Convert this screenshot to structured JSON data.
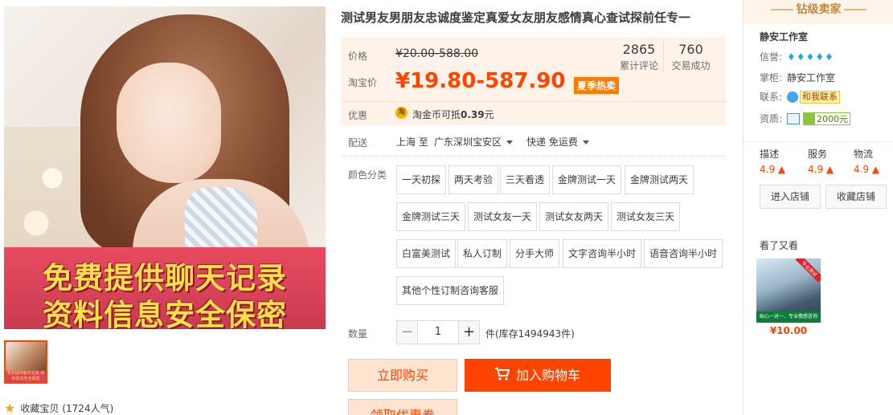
{
  "gallery": {
    "banner_line1": "免费提供聊天记录",
    "banner_line2": "资料信息安全保密",
    "thumb_text": "免费提供聊天记录 资料信息安全保密",
    "collect_label": "收藏宝贝",
    "collect_count": "(1724人气)"
  },
  "item": {
    "title": "测试男友男朋友忠诚度鉴定真爱女友朋友感情真心查试探前任专一",
    "price_label": "价格",
    "original_price": "¥20.00-588.00",
    "taobao_price_label": "淘宝价",
    "current_price": "¥19.80-587.90",
    "promo_tag": "夏季热卖",
    "stats": [
      {
        "num": "2865",
        "label": "累计评论"
      },
      {
        "num": "760",
        "label": "交易成功"
      }
    ],
    "benefit_label": "优惠",
    "coin_icon": "淘",
    "coin_text_prefix": "淘金币可抵",
    "coin_amount": "0.39",
    "coin_unit": "元",
    "ship_label": "配送",
    "ship_from": "上海 至",
    "ship_to": "广东深圳宝安区",
    "ship_method": "快递 免运费",
    "color_label": "颜色分类",
    "options": [
      "一天初探",
      "两天考验",
      "三天看透",
      "金牌测试一天",
      "金牌测试两天",
      "金牌测试三天",
      "测试女友一天",
      "测试女友两天",
      "测试女友三天",
      "白富美测试",
      "私人订制",
      "分手大师",
      "文字咨询半小时",
      "语音咨询半小时",
      "其他个性订制咨询客服"
    ],
    "qty_label": "数量",
    "qty_minus": "−",
    "qty_value": "1",
    "qty_plus": "+",
    "stock_text": "件(库存1494943件)",
    "buy_now": "立即购买",
    "add_to_cart": "加入购物车",
    "coupon": "领取优惠券"
  },
  "shop": {
    "level_title": "钻级卖家",
    "name": "静安工作室",
    "credit_label": "信誉:",
    "diamonds": 5,
    "owner_label": "掌柜:",
    "owner_name": "静安工作室",
    "contact_label": "联系:",
    "contact_btn": "和我联系",
    "cert_label": "资质:",
    "gold_amount": "2000元",
    "dsr": [
      {
        "label": "描述",
        "score": "4.9"
      },
      {
        "label": "服务",
        "score": "4.9"
      },
      {
        "label": "物流",
        "score": "4.9"
      }
    ],
    "enter_shop": "进入店铺",
    "fav_shop": "收藏店铺",
    "seen_title": "看了又看",
    "seen_banner": "贴心一对一、专业情感咨询",
    "seen_tag": "专业测试",
    "seen_price": "¥10.00"
  },
  "colors": {
    "accent": "#ff4400",
    "price_bg": "#fff2e8",
    "banner_red": "#d9445a",
    "banner_text": "#ffe04a"
  }
}
